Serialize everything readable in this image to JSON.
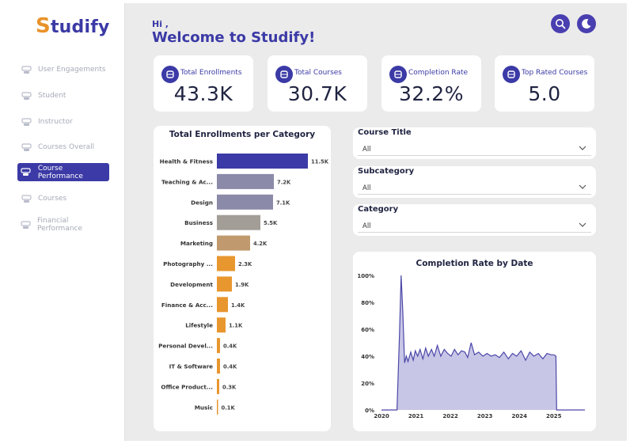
{
  "brand": {
    "name_first": "S",
    "name_rest": "tudify"
  },
  "sidebar": {
    "items": [
      {
        "label": "User Engagements",
        "icon": "users-icon",
        "active": false
      },
      {
        "label": "Student",
        "icon": "student-icon",
        "active": false
      },
      {
        "label": "Instructor",
        "icon": "instructor-icon",
        "active": false
      },
      {
        "label": "Courses Overall",
        "icon": "graduation-cap-icon",
        "active": false
      },
      {
        "label": "Course Performance",
        "icon": "performance-icon",
        "active": true
      },
      {
        "label": "Courses",
        "icon": "monitor-icon",
        "active": false
      },
      {
        "label": "Financial Performance",
        "icon": "finance-icon",
        "active": false
      }
    ]
  },
  "header": {
    "hi": "Hi ,",
    "welcome": "Welcome to Studify!"
  },
  "kpis": [
    {
      "label": "Total Enrollments",
      "value": "43.3K",
      "icon": "database-icon"
    },
    {
      "label": "Total Courses",
      "value": "30.7K",
      "icon": "grid-icon"
    },
    {
      "label": "Completion Rate",
      "value": "32.2%",
      "icon": "ring-icon"
    },
    {
      "label": "Top Rated Courses",
      "value": "5.0",
      "icon": "badge-icon"
    }
  ],
  "filters": [
    {
      "label": "Course Title",
      "value": "All"
    },
    {
      "label": "Subcategory",
      "value": "All"
    },
    {
      "label": "Category",
      "value": "All"
    }
  ],
  "colors": {
    "accent": "#3b3aa6",
    "background": "#ebebeb"
  },
  "chart_data": [
    {
      "type": "bar",
      "orientation": "horizontal",
      "title": "Total Enrollments per Category",
      "categories": [
        "Health & Fitness",
        "Teaching & Ac...",
        "Design",
        "Business",
        "Marketing",
        "Photography ...",
        "Development",
        "Finance & Acc...",
        "Lifestyle",
        "Personal Devel...",
        "IT & Software",
        "Office Product...",
        "Music"
      ],
      "values": [
        11.5,
        7.2,
        7.1,
        5.5,
        4.2,
        2.3,
        1.9,
        1.4,
        1.1,
        0.4,
        0.4,
        0.3,
        0.1
      ],
      "labels": [
        "11.5K",
        "7.2K",
        "7.1K",
        "5.5K",
        "4.2K",
        "2.3K",
        "1.9K",
        "1.4K",
        "1.1K",
        "0.4K",
        "0.4K",
        "0.3K",
        "0.1K"
      ],
      "bar_colors": [
        "#3b3aa6",
        "#8b8aa8",
        "#8b8aa8",
        "#a39d97",
        "#c09a6e",
        "#e8962e",
        "#e8962e",
        "#e8962e",
        "#e8962e",
        "#e8962e",
        "#e8962e",
        "#e8962e",
        "#e8962e"
      ],
      "unit": "K"
    },
    {
      "type": "area",
      "title": "Completion Rate by Date",
      "x_ticks": [
        "2020",
        "2021",
        "2022",
        "2023",
        "2024",
        "2025"
      ],
      "y_ticks": [
        "0%",
        "20%",
        "40%",
        "60%",
        "80%",
        "100%"
      ],
      "ylim": [
        0,
        100
      ],
      "xlim": [
        2020.0,
        2025.9
      ],
      "x": [
        2020.0,
        2020.45,
        2020.52,
        2020.57,
        2020.62,
        2020.67,
        2020.72,
        2020.77,
        2020.85,
        2020.92,
        2020.98,
        2021.05,
        2021.12,
        2021.2,
        2021.28,
        2021.36,
        2021.45,
        2021.53,
        2021.62,
        2021.72,
        2021.82,
        2021.92,
        2022.02,
        2022.12,
        2022.22,
        2022.32,
        2022.42,
        2022.5,
        2022.6,
        2022.7,
        2022.82,
        2022.94,
        2023.06,
        2023.18,
        2023.3,
        2023.42,
        2023.55,
        2023.68,
        2023.8,
        2023.92,
        2024.05,
        2024.18,
        2024.3,
        2024.42,
        2024.55,
        2024.68,
        2024.8,
        2024.92,
        2025.0,
        2025.06,
        2025.08,
        2025.9
      ],
      "y": [
        0,
        0,
        55,
        100,
        72,
        35,
        40,
        36,
        43,
        37,
        44,
        40,
        45,
        38,
        46,
        40,
        45,
        40,
        48,
        40,
        45,
        42,
        40,
        45,
        41,
        44,
        43,
        39,
        50,
        41,
        43,
        40,
        42,
        40,
        41,
        39,
        43,
        38,
        42,
        40,
        44,
        37,
        43,
        40,
        42,
        38,
        42,
        41,
        41,
        40,
        0,
        0
      ],
      "fill": "#c8c6e6",
      "stroke": "#4b47a8"
    }
  ]
}
